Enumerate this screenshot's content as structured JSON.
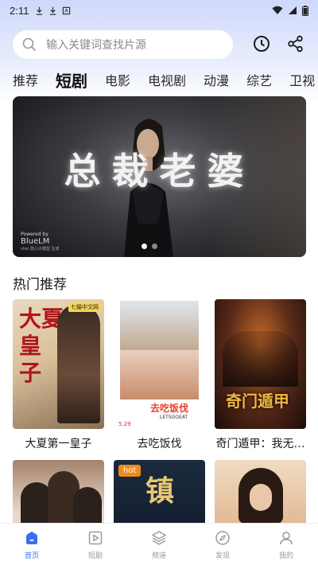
{
  "status_bar": {
    "time": "2:11"
  },
  "search": {
    "placeholder": "输入关键词查找片源"
  },
  "tabs": [
    "推荐",
    "短剧",
    "电影",
    "电视剧",
    "动漫",
    "综艺",
    "卫视"
  ],
  "active_tab": "短剧",
  "banner": {
    "title": "总裁老婆",
    "credit_line1": "Powered by",
    "credit_line2": "BlueLM",
    "credit_line3": "vivo 蓝心大模型 生成"
  },
  "section": {
    "title": "热门推荐"
  },
  "cards": [
    {
      "title": "大夏第一皇子",
      "poster_text": "大夏\n第一\n皇子",
      "poster_badge": "七猫中文网"
    },
    {
      "title": "去吃饭伐",
      "poster_text": "去吃饭伐",
      "poster_sub": "LETSGOEAT",
      "poster_num": "5.29"
    },
    {
      "title": "奇门遁甲：我无…",
      "poster_text": "奇门遁甲"
    },
    {
      "title": "",
      "poster_text": ""
    },
    {
      "title": "",
      "poster_text": "镇",
      "badge": "hot"
    },
    {
      "title": "",
      "poster_text": ""
    }
  ],
  "bottom_nav": [
    {
      "label": "首页",
      "icon": "home-icon",
      "active": true
    },
    {
      "label": "短剧",
      "icon": "play-icon",
      "active": false
    },
    {
      "label": "频道",
      "icon": "layers-icon",
      "active": false
    },
    {
      "label": "发现",
      "icon": "compass-icon",
      "active": false
    },
    {
      "label": "我的",
      "icon": "user-icon",
      "active": false
    }
  ],
  "colors": {
    "accent": "#3a6df0",
    "hot": "#f08a1c"
  }
}
